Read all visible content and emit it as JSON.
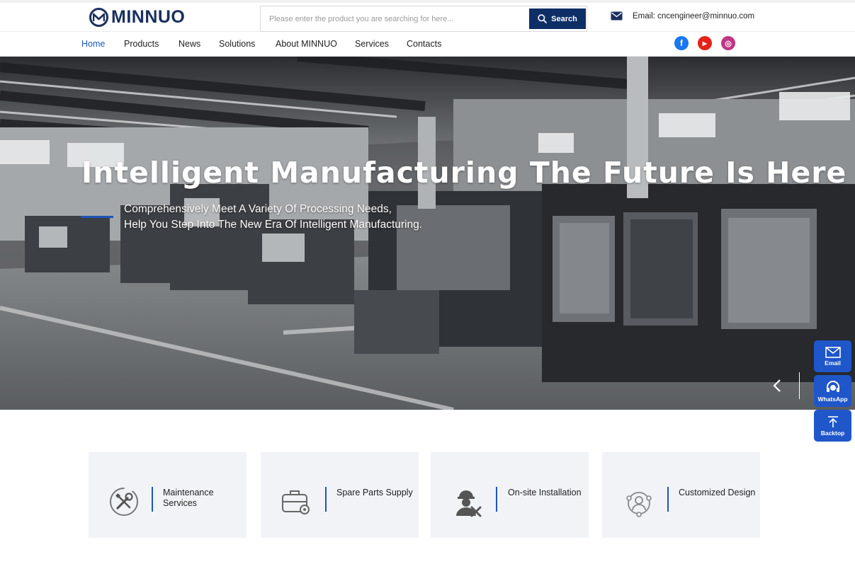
{
  "brand": {
    "name": "MINNUO",
    "logo_initial": "M",
    "color": "#1a2f5e"
  },
  "search": {
    "placeholder": "Please enter the product you are searching for here...",
    "value": "",
    "button_label": "Search",
    "button_color": "#0e2e66"
  },
  "contact": {
    "email_text": "Email: cncengineer@minnuo.com",
    "icon": "envelope-icon"
  },
  "nav": {
    "items": [
      {
        "label": "Home",
        "active": true
      },
      {
        "label": "Products",
        "active": false
      },
      {
        "label": "News",
        "active": false
      },
      {
        "label": "Solutions",
        "active": false
      },
      {
        "label": "About MINNUO",
        "active": false
      },
      {
        "label": "Services",
        "active": false
      },
      {
        "label": "Contacts",
        "active": false
      }
    ],
    "active_color": "#1e56b8",
    "social": [
      {
        "name": "facebook-icon",
        "glyph": "f",
        "color": "#1877f2"
      },
      {
        "name": "youtube-icon",
        "glyph": "▶",
        "color": "#e62117"
      },
      {
        "name": "instagram-icon",
        "glyph": "◎",
        "color": "#c13584"
      }
    ]
  },
  "hero": {
    "title": "Intelligent Manufacturing The Future Is Here",
    "subtitle_line1": "Comprehensively Meet A Variety Of Processing Needs,",
    "subtitle_line2": "Help You Step Into The New Era Of Intelligent Manufacturing.",
    "prev_glyph": "‹",
    "background": "grayscale factory floor with CNC machines"
  },
  "floating": [
    {
      "label": "Email",
      "icon": "envelope-icon"
    },
    {
      "label": "WhatsApp",
      "icon": "headset-icon"
    },
    {
      "label": "Backtop",
      "icon": "arrow-up-icon"
    }
  ],
  "services": [
    {
      "label": "Maintenance Services",
      "icon": "tools-icon"
    },
    {
      "label": "Spare Parts Supply",
      "icon": "toolbox-gear-icon"
    },
    {
      "label": "On-site Installation",
      "icon": "worker-icon"
    },
    {
      "label": "Customized Design",
      "icon": "people-network-icon"
    }
  ],
  "accent_color": "#1f56c9"
}
